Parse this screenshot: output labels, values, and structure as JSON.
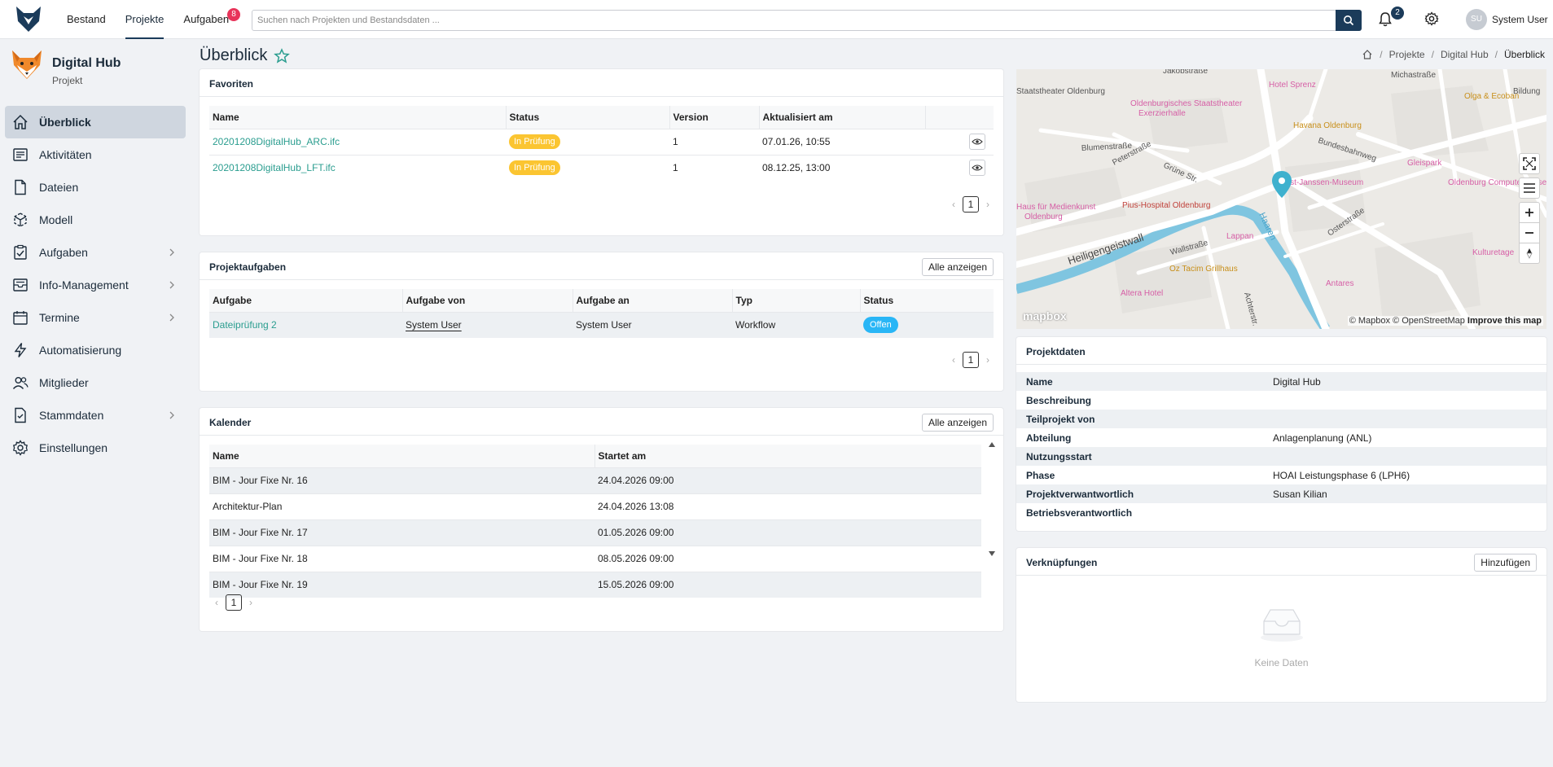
{
  "topbar": {
    "logo_icon": "fox-logo-icon",
    "nav": [
      {
        "label": "Bestand"
      },
      {
        "label": "Projekte"
      },
      {
        "label": "Aufgaben",
        "badge": "8"
      }
    ],
    "search_placeholder": "Suchen nach Projekten und Bestandsdaten ...",
    "notifications_count": "2",
    "user_initials": "SU",
    "user_name": "System User"
  },
  "sidebar": {
    "project_name": "Digital Hub",
    "project_type": "Projekt",
    "items": [
      {
        "label": "Überblick",
        "icon": "home-icon",
        "active": true
      },
      {
        "label": "Aktivitäten",
        "icon": "activity-icon"
      },
      {
        "label": "Dateien",
        "icon": "file-icon"
      },
      {
        "label": "Modell",
        "icon": "model-icon"
      },
      {
        "label": "Aufgaben",
        "icon": "tasks-icon",
        "has_submenu": true
      },
      {
        "label": "Info-Management",
        "icon": "inbox-icon",
        "has_submenu": true
      },
      {
        "label": "Termine",
        "icon": "calendar-icon",
        "has_submenu": true
      },
      {
        "label": "Automatisierung",
        "icon": "lightning-icon"
      },
      {
        "label": "Mitglieder",
        "icon": "users-icon"
      },
      {
        "label": "Stammdaten",
        "icon": "master-data-icon",
        "has_submenu": true
      },
      {
        "label": "Einstellungen",
        "icon": "gear-icon"
      }
    ]
  },
  "page": {
    "title": "Überblick",
    "breadcrumb": [
      "Projekte",
      "Digital Hub",
      "Überblick"
    ]
  },
  "favoriten": {
    "title": "Favoriten",
    "columns": [
      "Name",
      "Status",
      "Version",
      "Aktualisiert am"
    ],
    "rows": [
      {
        "name": "20201208DigitalHub_ARC.ifc",
        "status": "In Prüfung",
        "version": "1",
        "updated": "07.01.26, 10:55"
      },
      {
        "name": "20201208DigitalHub_LFT.ifc",
        "status": "In Prüfung",
        "version": "1",
        "updated": "08.12.25, 13:00"
      }
    ],
    "page": "1"
  },
  "projektaufgaben": {
    "title": "Projektaufgaben",
    "button": "Alle anzeigen",
    "columns": [
      "Aufgabe",
      "Aufgabe von",
      "Aufgabe an",
      "Typ",
      "Status"
    ],
    "rows": [
      {
        "task": "Dateiprüfung 2",
        "from": "System User",
        "to": "System User",
        "type": "Workflow",
        "status": "Offen"
      }
    ],
    "page": "1"
  },
  "kalender": {
    "title": "Kalender",
    "button": "Alle anzeigen",
    "columns": [
      "Name",
      "Startet am"
    ],
    "rows": [
      {
        "name": "BIM - Jour Fixe Nr. 16",
        "start": "24.04.2026 09:00"
      },
      {
        "name": "Architektur-Plan",
        "start": "24.04.2026 13:08"
      },
      {
        "name": "BIM - Jour Fixe Nr. 17",
        "start": "01.05.2026 09:00"
      },
      {
        "name": "BIM - Jour Fixe Nr. 18",
        "start": "08.05.2026 09:00"
      },
      {
        "name": "BIM - Jour Fixe Nr. 19",
        "start": "15.05.2026 09:00"
      }
    ],
    "page": "1"
  },
  "map": {
    "attribution": "© Mapbox © OpenStreetMap",
    "improve": "Improve this map",
    "logo": "mapbox",
    "labels": {
      "l1": "Jakobstraße",
      "l2": "Staatstheater Oldenburg",
      "l3": "Oldenburgisches Staatstheater",
      "l4": "Exerzierhalle",
      "l5": "Hotel Sprenz",
      "l6": "Michastraße",
      "l7": "Olga & Ecoban",
      "l8": "Bildung",
      "l9": "Havana Oldenburg",
      "l10": "Blumenstraße",
      "l11": "Peterstraße",
      "l12": "Grüne Str.",
      "l13": "Bundesbahnweg",
      "l14": "Horst-Janssen-Museum",
      "l15": "Gleispark",
      "l16": "Haus für Medienkunst",
      "l17": "Oldenburg",
      "l18": "Pius-Hospital Oldenburg",
      "l19": "Haaren",
      "l20": "Osterstraße",
      "l21": "Oldenburg Computer-Museum",
      "l22": "Lappan",
      "l23": "Heiligengeistwall",
      "l24": "Wallstraße",
      "l25": "Oz Tacim Grillhaus",
      "l26": "Kulturetage",
      "l27": "Altera Hotel",
      "l28": "Achterstr.",
      "l29": "Antares"
    }
  },
  "projektdaten": {
    "title": "Projektdaten",
    "rows": [
      {
        "key": "Name",
        "value": "Digital Hub"
      },
      {
        "key": "Beschreibung",
        "value": ""
      },
      {
        "key": "Teilprojekt von",
        "value": ""
      },
      {
        "key": "Abteilung",
        "value": "Anlagenplanung (ANL)"
      },
      {
        "key": "Nutzungsstart",
        "value": ""
      },
      {
        "key": "Phase",
        "value": "HOAI Leistungsphase 6 (LPH6)"
      },
      {
        "key": "Projektverwantwortlich",
        "value": "Susan Kilian"
      },
      {
        "key": "Betriebsverantwortlich",
        "value": ""
      }
    ]
  },
  "verknuepfungen": {
    "title": "Verknüpfungen",
    "button": "Hinzufügen",
    "empty": "Keine Daten"
  },
  "colors": {
    "primary": "#1b3b5a",
    "link": "#2a9d8f",
    "badge_red": "#e8345a",
    "status_yellow": "#fbc531",
    "status_blue": "#29b6f6"
  }
}
